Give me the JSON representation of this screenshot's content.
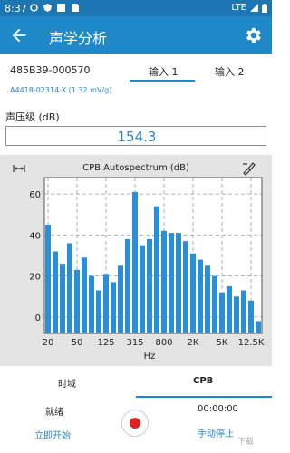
{
  "status_bar": {
    "time": "8:37",
    "network": "LTE"
  },
  "app_bar": {
    "title": "声学分析",
    "back_icon": "arrow-back-icon",
    "settings_icon": "gear-icon"
  },
  "device": {
    "id": "485B39-000570",
    "sensor": "A4418-02314-X (1.32 mV/g)"
  },
  "inputs": {
    "tabs": [
      "输入 1",
      "输入 2"
    ],
    "selected": 0
  },
  "spl": {
    "label": "声压级 (dB)",
    "value": "154.3"
  },
  "chart_data": {
    "type": "bar",
    "title": "CPB Autospectrum (dB)",
    "xlabel": "Hz",
    "ylabel": "",
    "ylim": [
      -8,
      68
    ],
    "yticks": [
      0,
      20,
      40,
      60
    ],
    "grid": true,
    "x_tick_labels": [
      "20",
      "50",
      "125",
      "315",
      "800",
      "2K",
      "5K",
      "12.5K"
    ],
    "x_tick_bar_index": [
      0,
      4,
      8,
      12,
      16,
      20,
      24,
      28
    ],
    "values": [
      45,
      32,
      26,
      36,
      23,
      29,
      20,
      13,
      21,
      17,
      25,
      38,
      61,
      35,
      38,
      54,
      42,
      41,
      41,
      37,
      31,
      28,
      25,
      20,
      12,
      15,
      10,
      13,
      8,
      -2
    ],
    "bar_color": "#2b8fd6"
  },
  "chart_icons": {
    "left": "range-arrows-icon",
    "right": "brush-icon"
  },
  "lower_tabs": {
    "items": [
      "时域",
      "CPB"
    ],
    "selected": 1
  },
  "recording": {
    "state": "就绪",
    "timer": "00:00:00",
    "start": "立即开始",
    "manual": "手动停止"
  },
  "watermark": "下载"
}
